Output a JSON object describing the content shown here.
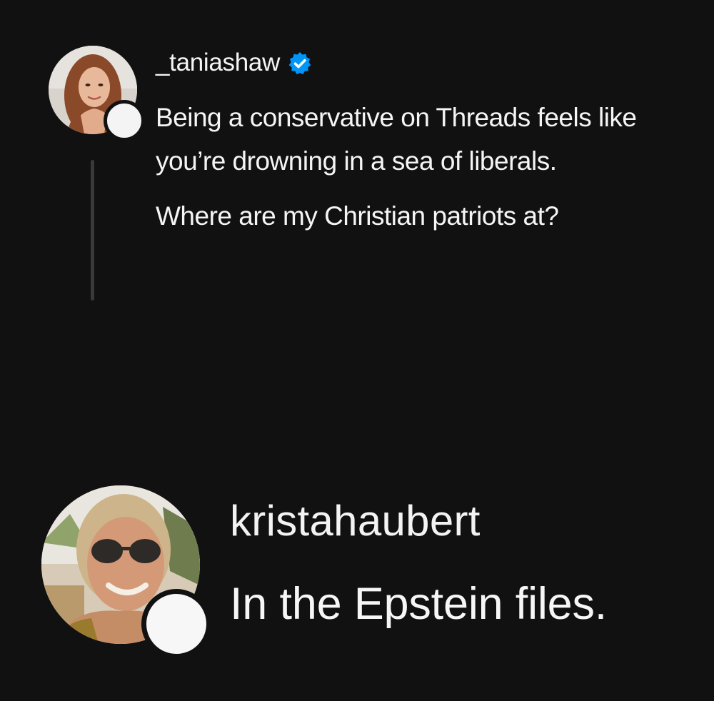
{
  "posts": [
    {
      "username": "_taniashaw",
      "verified": true,
      "body_lines": [
        "Being a conservative on Threads feels like you’re drowning in a sea of liberals.",
        "Where are my Christian patriots at?"
      ]
    },
    {
      "username": "kristahaubert",
      "verified": false,
      "body_lines": [
        "In the Epstein files."
      ]
    }
  ],
  "colors": {
    "background": "#111111",
    "text": "#f5f5f5",
    "verified_badge": "#0095f6",
    "thread_line": "#3a3a3a"
  },
  "icons": {
    "verified": "verified-badge-icon"
  }
}
